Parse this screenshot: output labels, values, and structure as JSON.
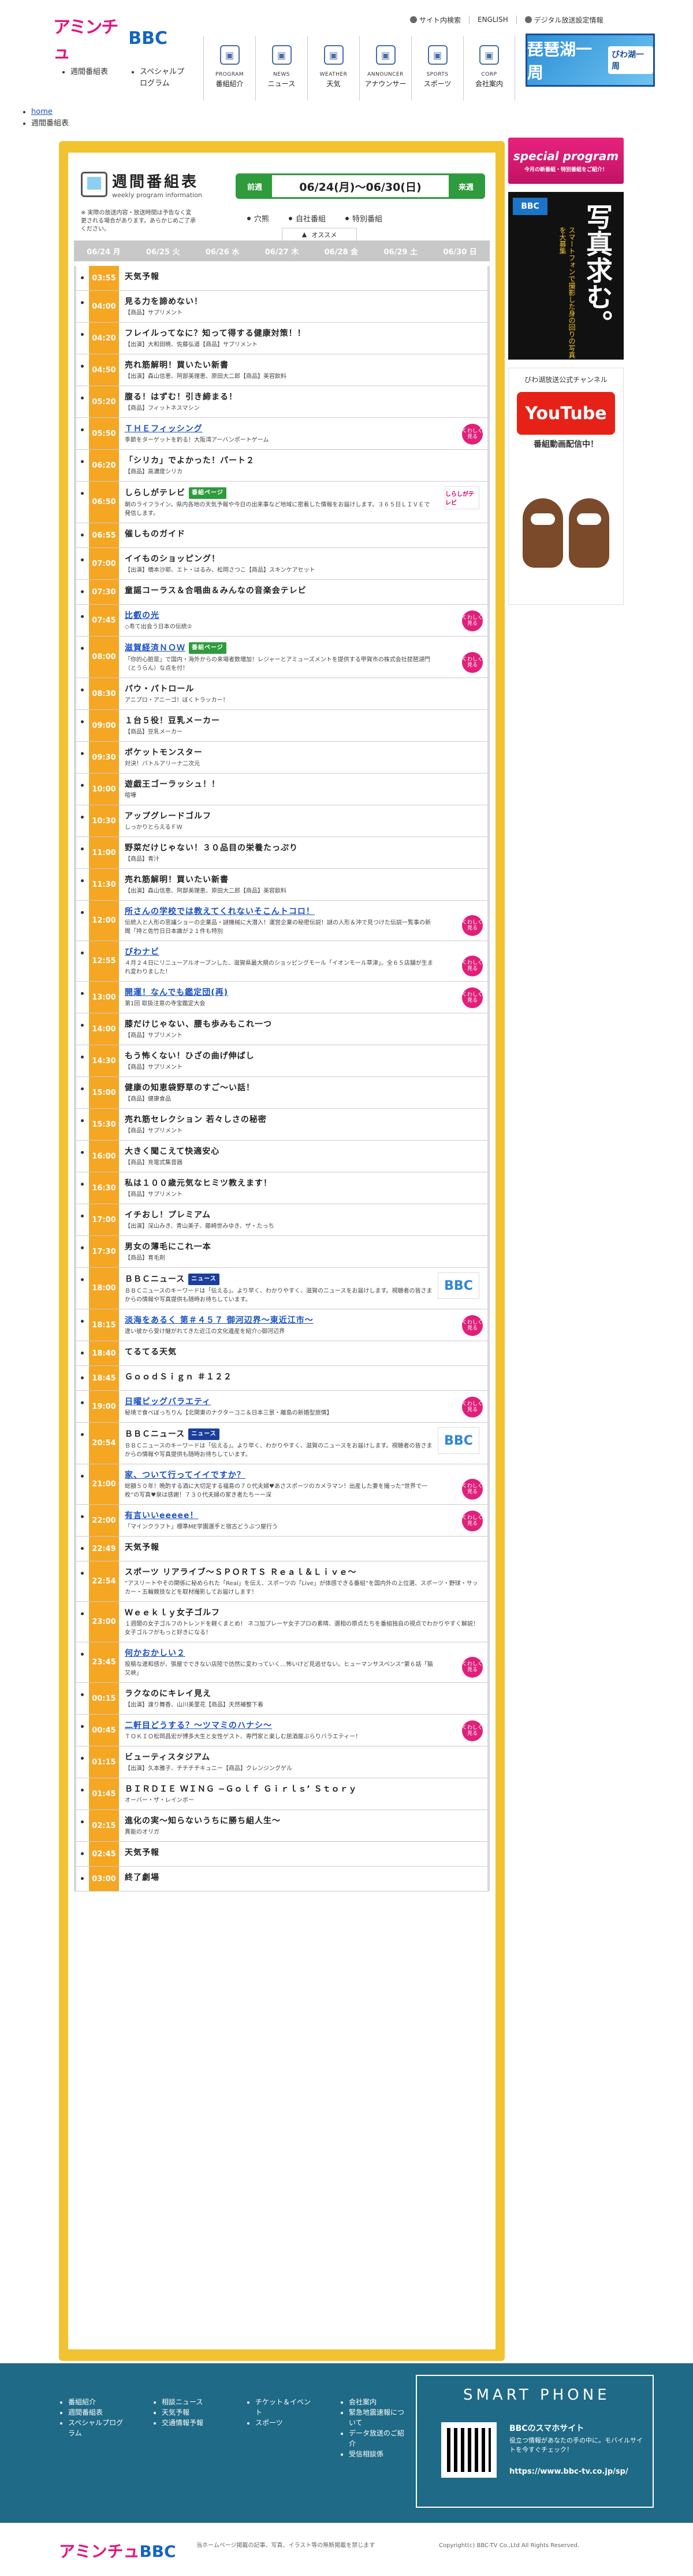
{
  "header": {
    "util": {
      "sitemap": "サイト内検索",
      "english": "ENGLISH",
      "digital": "デジタル放送設定情報"
    },
    "logo_a": "アミンチュ",
    "logo_b": "BBC",
    "subnav": [
      "週間番組表",
      "スペシャルプログラム"
    ],
    "mainnav": [
      {
        "en": "PROGRAM",
        "ja": "番組紹介",
        "icon": "tv-icon"
      },
      {
        "en": "NEWS",
        "ja": "ニュース",
        "icon": "news-icon"
      },
      {
        "en": "WEATHER",
        "ja": "天気",
        "icon": "weather-icon"
      },
      {
        "en": "ANNOUNCER",
        "ja": "アナウンサー",
        "icon": "announcer-icon"
      },
      {
        "en": "SPORTS",
        "ja": "スポーツ",
        "icon": "sports-icon"
      },
      {
        "en": "CORP",
        "ja": "会社案内",
        "icon": "building-icon"
      }
    ],
    "banner_main": "琵琶湖一周",
    "banner_sub": "びわ湖一周"
  },
  "breadcrumb": [
    "home",
    "週間番組表"
  ],
  "schedule": {
    "title_ja": "週間番組表",
    "title_en": "weekly program information",
    "note": "※ 実際の放送内容・放送時間は予告なく変更される場合があります。あらかじめご了承ください。",
    "prev": "前週",
    "next": "来週",
    "range": "06/24(月)〜06/30(日)",
    "legend": [
      "穴熊",
      "自社番組",
      "特別番組"
    ],
    "pick_tab": "オススメ",
    "days": [
      "06/24 月",
      "06/25 火",
      "06/26 水",
      "06/27 木",
      "06/28 金",
      "06/29 土",
      "06/30 日"
    ],
    "programs": [
      {
        "time": "03:55",
        "title": "天気予報",
        "desc": ""
      },
      {
        "time": "04:00",
        "title": "見る力を諦めない！",
        "desc": "【商品】サプリメント"
      },
      {
        "time": "04:20",
        "title": "フレイルってなに？知って得する健康対策！！",
        "desc": "【出演】大和田暁、佐藤弘道【商品】サプリメント"
      },
      {
        "time": "04:50",
        "title": "売れ筋解明！買いたい新書",
        "desc": "【出演】森山信恵、阿部美理恵、原田大二郎【商品】美容飲料"
      },
      {
        "time": "05:20",
        "title": "腹る！はずむ！引き締まる！",
        "desc": "【商品】フィットネスマシン"
      },
      {
        "time": "05:50",
        "title": "ＴＨＥフィッシング",
        "desc": "季節をターゲットを釣る！大阪湾アーバンポートゲーム",
        "link": true,
        "more": "くわしく見る"
      },
      {
        "time": "06:20",
        "title": "「シリカ」でよかった！パート２",
        "desc": "【商品】高濃度シリカ"
      },
      {
        "time": "06:50",
        "title": "しらしがテレビ",
        "badge": "番組ページ",
        "desc": "朝のライフライン。県内各地の天気予報や今日の出来事など地域に密着した情報をお届けします。３６５日ＬＩＶＥで発信します。",
        "thumb": "しらしがテレビ"
      },
      {
        "time": "06:55",
        "title": "催しものガイド",
        "desc": ""
      },
      {
        "time": "07:00",
        "title": "イイものショッピング！",
        "desc": "【出演】橋本沙耶、エト・はるみ、松岡さつこ【商品】スキンケアセット"
      },
      {
        "time": "07:30",
        "title": "童謡コーラス＆合唱曲＆みんなの音楽会テレビ",
        "desc": ""
      },
      {
        "time": "07:45",
        "title": "比叡の光",
        "desc": "◇寿て出会う日本の伝統②",
        "link": true,
        "more": "くわしく見る"
      },
      {
        "time": "08:00",
        "title": "滋賀経済ＮＯＷ",
        "badge": "番組ページ",
        "desc": "「你的心脏是」で国内・海外からの来場者数増加！レジャーとアミューズメントを提供する甲賀市の株式会社琵琶湖門（とうらん）な点を付！",
        "link": true,
        "more": "くわしく見る"
      },
      {
        "time": "08:30",
        "title": "パウ・パトロール",
        "desc": "アニプロ・アニーゴ！ぼくトラッカー！"
      },
      {
        "time": "09:00",
        "title": "１台５役！豆乳メーカー",
        "desc": "【商品】豆乳メーカー"
      },
      {
        "time": "09:30",
        "title": "ポケットモンスター",
        "desc": "対決！バトルアリーナ二次元"
      },
      {
        "time": "10:00",
        "title": "遊戯王ゴーラッシュ！！",
        "desc": "喧嘩"
      },
      {
        "time": "10:30",
        "title": "アップグレードゴルフ",
        "desc": "しっかりとらえるＦＷ"
      },
      {
        "time": "11:00",
        "title": "野菜だけじゃない！３０品目の栄養たっぷり",
        "desc": "【商品】青汁"
      },
      {
        "time": "11:30",
        "title": "売れ筋解明！買いたい新書",
        "desc": "【出演】森山信恵、阿部美理恵、原田大二郎【商品】美容飲料"
      },
      {
        "time": "12:00",
        "title": "所さんの学校では教えてくれないそこんトコロ！",
        "desc": "伝統人と人形の思議ショーの企業品・謎機械に大潜入！運営企業の秘密伝説！謎の人形＆沖で見つけた伝説一覧事の新聞「持と佐竹日日本誰が２１件も特別",
        "link": true,
        "more": "くわしく見る"
      },
      {
        "time": "12:55",
        "title": "びわナビ",
        "desc": "４月２４日にリニューアルオープンした、滋賀県最大規のショッピングモール「イオンモール草津」。全６５店舗が生まれ変わりました！",
        "link": true,
        "more": "くわしく見る"
      },
      {
        "time": "13:00",
        "title": "開運！なんでも鑑定団(再)",
        "desc": "第1回 取扱注意の寺宝鑑定大会",
        "link": true,
        "more": "くわしく見る"
      },
      {
        "time": "14:00",
        "title": "膝だけじゃない、腰も歩みもこれ一つ",
        "desc": "【商品】サプリメント"
      },
      {
        "time": "14:30",
        "title": "もう怖くない！ひざの曲げ伸ばし",
        "desc": "【商品】サプリメント"
      },
      {
        "time": "15:00",
        "title": "健康の知恵袋野草のすご〜い話！",
        "desc": "【商品】健康食品"
      },
      {
        "time": "15:30",
        "title": "売れ筋セレクション 若々しさの秘密",
        "desc": "【商品】サプリメント"
      },
      {
        "time": "16:00",
        "title": "大きく聞こえて快適安心",
        "desc": "【商品】充電式集音器"
      },
      {
        "time": "16:30",
        "title": "私は１００歳元気なヒミツ教えます！",
        "desc": "【商品】サプリメント"
      },
      {
        "time": "17:00",
        "title": "イチおし！プレミアム",
        "desc": "【出演】深山みき、青山美子、藤崎世みゆき、ザ・たっち"
      },
      {
        "time": "17:30",
        "title": "男女の薄毛にこれ一本",
        "desc": "【商品】育毛剤"
      },
      {
        "time": "18:00",
        "title": "ＢＢＣニュース",
        "badge": "ニュース",
        "badge_blue": true,
        "desc": "ＢＢＣニュースのキーワードは「伝える」。より早く、わかりやすく、滋賀のニュースをお届けします。視聴者の皆さまからの情報や写真提供も随時お待ちしています。",
        "thumb": "BBC"
      },
      {
        "time": "18:15",
        "title": "淡海をあるく 第＃４５７ 御河辺界〜東近江市〜",
        "desc": "違い彼から受け継がれてきた近江の文化遺産を紹介◇御河辺界",
        "link": true,
        "more": "くわしく見る"
      },
      {
        "time": "18:40",
        "title": "てるてる天気",
        "desc": ""
      },
      {
        "time": "18:45",
        "title": "ＧｏｏｄＳｉｇｎ ＃１２２",
        "desc": ""
      },
      {
        "time": "19:00",
        "title": "日曜ビッグバラエティ",
        "desc": "秘境で食べぼっちりん【北関東のナクターコニ＆日本三景・離島の新婚型旅情】",
        "link": true,
        "more": "くわしく見る"
      },
      {
        "time": "20:54",
        "title": "ＢＢＣニュース",
        "badge": "ニュース",
        "badge_blue": true,
        "desc": "ＢＢＣニュースのキーワードは「伝える」。より早く、わかりやすく、滋賀のニュースをお届けします。視聴者の皆さまからの情報や写真提供も随時お待ちしています。",
        "thumb": "BBC"
      },
      {
        "time": "21:00",
        "title": "家、ついて行ってイイですか？",
        "desc": "総額５０年！晩酌する酒に大切足する福島の７０代夫婦♥あさスポーツのカメラマン！出産した妻を撮った”世界で一枚”の写真♥泉は感謝！７３０代夫婦の家き者たちーー深",
        "link": true,
        "more": "くわしく見る"
      },
      {
        "time": "22:00",
        "title": "有言いいeeeee！",
        "desc": "「マインクラフト」標準ME学園選手と宿古どうぶつ屋行う",
        "link": true,
        "more": "くわしく見る"
      },
      {
        "time": "22:49",
        "title": "天気予報",
        "desc": ""
      },
      {
        "time": "22:54",
        "title": "スポーツ リアライブ〜ＳＰＯＲＴＳ Ｒｅａｌ＆Ｌｉｖｅ〜",
        "desc": "”アスリートやその関係に秘められた「Real」を伝え、スポーツの「Live」が体感できる番組”を国内外の上位選、スポーツ・野球・サッカー・五輪競技などを取材撮影してお届けします！"
      },
      {
        "time": "23:00",
        "title": "Ｗｅｅｋｌｙ女子ゴルフ",
        "desc": "１週間の女子ゴルフのトレンドを軽くまとめ！ ネコ加プレーヤ女子プロの素晴、選相の原点たちを番組独自の視点でわかりやすく解説！女子ゴルフがもっと好きになる！"
      },
      {
        "time": "23:45",
        "title": "何かおかしい２",
        "desc": "投稿な違和感が、張屋でできない店陸で彷然に変わっていく…怖いけど見逃せない。ヒューマンサスペンス”第６話「猫又峡」",
        "link": true,
        "more": "くわしく見る"
      },
      {
        "time": "00:15",
        "title": "ラクなのにキレイ見え",
        "desc": "【出演】渡り舞香、山川美里花【商品】天然補整下着"
      },
      {
        "time": "00:45",
        "title": "二軒目どうする？〜ツマミのハナシ〜",
        "desc": "ＴＯＫＩＯ松岡昌宏が博多大生と女性ゲスト、専門家と楽しむ居酒屋ぶらりバラエティー！",
        "link": true,
        "more": "くわしく見る"
      },
      {
        "time": "01:15",
        "title": "ビューティスタジアム",
        "desc": "【出演】久本雅子、チチチチキュニー【商品】クレンジングゲル"
      },
      {
        "time": "01:45",
        "title": "ＢＩＲＤＩＥ ＷＩＮＧ −Ｇｏｌｆ Ｇｉｒｌｓ’ Ｓｔｏｒｙ",
        "desc": "オーバー・ザ・レインボー"
      },
      {
        "time": "02:15",
        "title": "進化の実〜知らないうちに勝ち組人生〜",
        "desc": "異能のオリガ"
      },
      {
        "time": "02:45",
        "title": "天気予報",
        "desc": ""
      },
      {
        "time": "03:00",
        "title": "終了劇場",
        "desc": ""
      }
    ]
  },
  "sidebar": {
    "special_big": "special program",
    "special_sm": "今月の新番組・特別番組をご紹介！",
    "photo_logo": "BBC",
    "photo_big": "写真求む。",
    "photo_sm": "スマートフォンで撮影した身の回りの写真を大募集",
    "yt_cap": "びわ湖放送公式チャンネル",
    "yt_logo": "YouTube",
    "yt_sub": "番組動画配信中！"
  },
  "footer": {
    "cols": [
      [
        "番組紹介",
        "週間番組表",
        "スペシャルプログラム"
      ],
      [
        "相談ニュース",
        "天気予報",
        "交通情報予報"
      ],
      [
        "チケット＆イベント",
        "スポーツ"
      ],
      [
        "会社案内",
        "緊急地震速報について",
        "データ放送のご紹介",
        "受信相談係"
      ]
    ],
    "sp_title": "SMART PHONE",
    "sp_name": "BBCのスマホサイト",
    "sp_text": "役立つ情報があなたの手の中に。モバイルサイトを今すぐチェック！",
    "sp_url": "https://www.bbc-tv.co.jp/sp/",
    "note": "当ホームページ掲載の記事、写真、イラスト等の無断掲載を禁じます",
    "copy": "Copyright(c) BBC-TV Co.,Ltd All Rights Reserved."
  },
  "colors": {
    "accent": "#f2c331",
    "time": "#f5a623",
    "nav": "#2e9b3c",
    "footer": "#1f6a86",
    "pink": "#e0207a"
  }
}
